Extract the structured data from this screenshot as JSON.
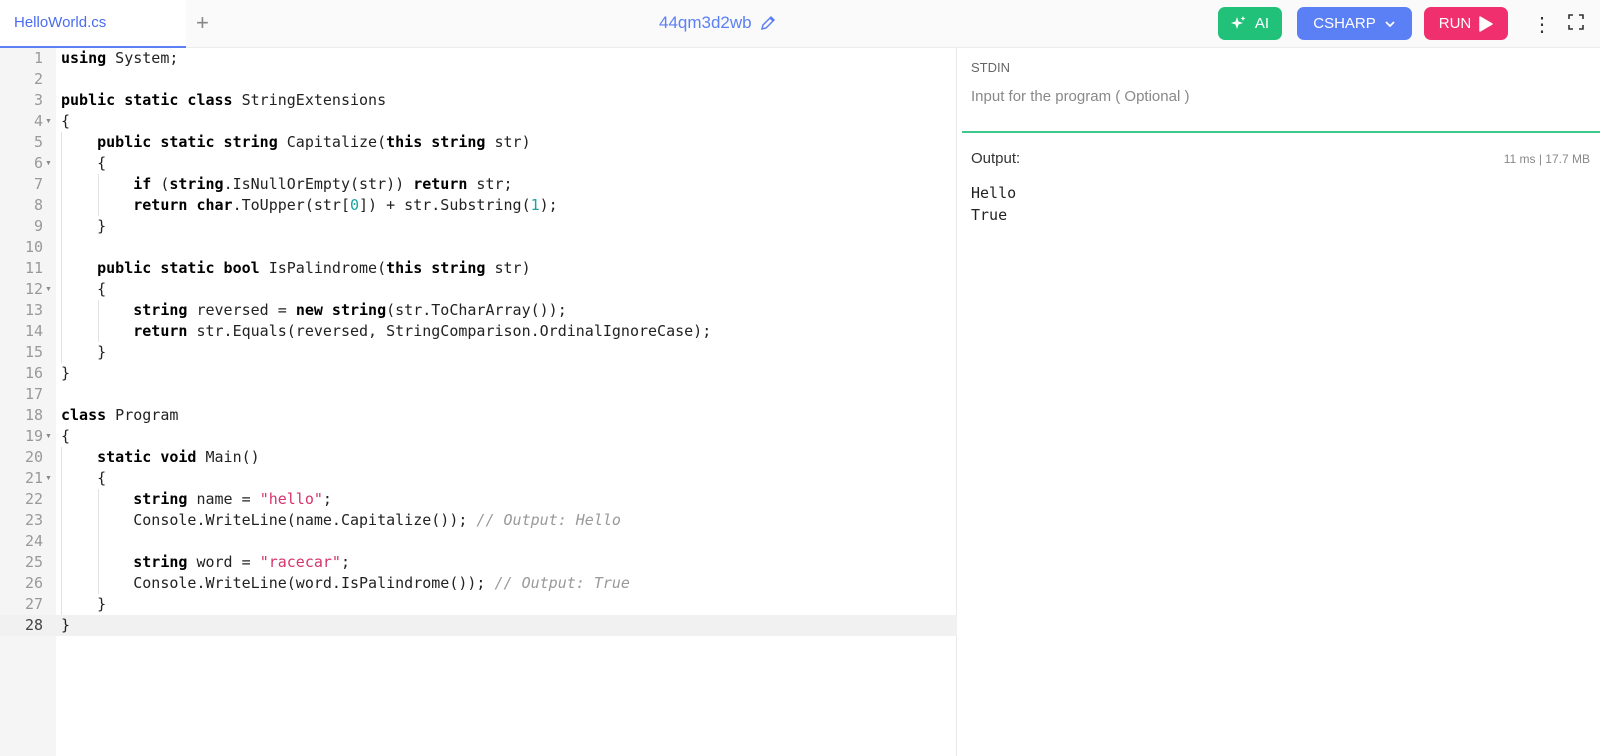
{
  "header": {
    "tab_label": "HelloWorld.cs",
    "add_tab": "+",
    "project_name": "44qm3d2wb",
    "ai_label": "AI",
    "language_label": "CSHARP",
    "run_label": "RUN",
    "more_icon": "⋮"
  },
  "editor": {
    "lines": [
      "1",
      "2",
      "3",
      "4",
      "5",
      "6",
      "7",
      "8",
      "9",
      "10",
      "11",
      "12",
      "13",
      "14",
      "15",
      "16",
      "17",
      "18",
      "19",
      "20",
      "21",
      "22",
      "23",
      "24",
      "25",
      "26",
      "27",
      "28"
    ]
  },
  "stdin": {
    "label": "STDIN",
    "placeholder": "Input for the program ( Optional )"
  },
  "output": {
    "label": "Output:",
    "stats": "11 ms | 17.7 MB",
    "line1": "Hello",
    "line2": "True"
  },
  "colors": {
    "accent": "#5b7ff5",
    "ai": "#21c17a",
    "run": "#ef2f6e",
    "string": "#d6336c",
    "number": "#1ba1a1",
    "comment": "#999999"
  }
}
